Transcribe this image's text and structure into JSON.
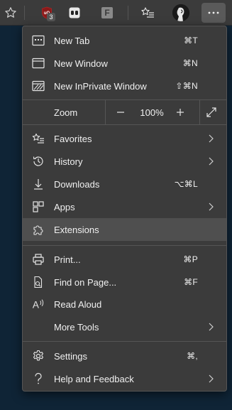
{
  "toolbar": {
    "ublock_badge": "3",
    "ext_letter": "F",
    "icons": [
      "star-outline-icon",
      "ublock-origin-icon",
      "ghostery-icon",
      "f-extension-icon",
      "favorites-bar-icon",
      "profile-avatar",
      "more-icon"
    ]
  },
  "menu": {
    "new_tab": {
      "label": "New Tab",
      "shortcut": "⌘T"
    },
    "new_window": {
      "label": "New Window",
      "shortcut": "⌘N"
    },
    "inprivate": {
      "label": "New InPrivate Window",
      "shortcut": "⇧⌘N"
    },
    "zoom": {
      "label": "Zoom",
      "minus": "—",
      "value": "100%",
      "plus": "+"
    },
    "favorites": {
      "label": "Favorites"
    },
    "history": {
      "label": "History"
    },
    "downloads": {
      "label": "Downloads",
      "shortcut": "⌥⌘L"
    },
    "apps": {
      "label": "Apps"
    },
    "extensions": {
      "label": "Extensions"
    },
    "print": {
      "label": "Print...",
      "shortcut": "⌘P"
    },
    "find": {
      "label": "Find on Page...",
      "shortcut": "⌘F"
    },
    "read_aloud": {
      "label": "Read Aloud"
    },
    "more_tools": {
      "label": "More Tools"
    },
    "settings": {
      "label": "Settings",
      "shortcut": "⌘,"
    },
    "help": {
      "label": "Help and Feedback"
    }
  },
  "colors": {
    "menu_bg": "#3b3b3b",
    "highlight_bg": "#4f4f4f",
    "page_bg": "#0f2436",
    "ublock_red": "#8b1a1a"
  }
}
